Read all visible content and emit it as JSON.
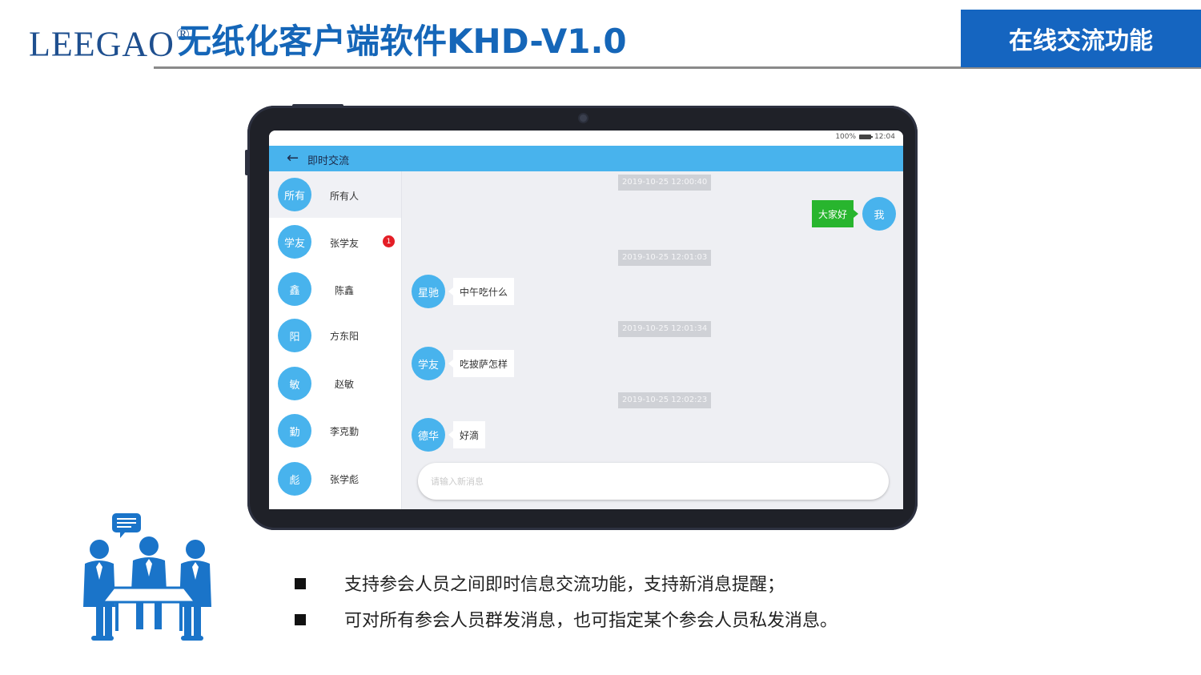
{
  "header": {
    "brand": "LEEGAO",
    "brand_mark": "®",
    "product_title": "无纸化客户端软件KHD-V1.0",
    "feature_tab": "在线交流功能"
  },
  "device": {
    "status": {
      "battery": "100%",
      "time": "12:04"
    },
    "appbar": {
      "title": "即时交流"
    },
    "contacts": [
      {
        "avatar": "所有",
        "name": "所有人",
        "selected": true
      },
      {
        "avatar": "学友",
        "name": "张学友",
        "unread": "1"
      },
      {
        "avatar": "鑫",
        "name": "陈鑫"
      },
      {
        "avatar": "阳",
        "name": "方东阳"
      },
      {
        "avatar": "敏",
        "name": "赵敏"
      },
      {
        "avatar": "勤",
        "name": "李克勤"
      },
      {
        "avatar": "彪",
        "name": "张学彪"
      }
    ],
    "messages": [
      {
        "time": "2019-10-25 12:00:40",
        "direction": "out",
        "avatar": "我",
        "text": "大家好"
      },
      {
        "time": "2019-10-25 12:01:03",
        "direction": "in",
        "avatar": "星驰",
        "text": "中午吃什么"
      },
      {
        "time": "2019-10-25 12:01:34",
        "direction": "in",
        "avatar": "学友",
        "text": "吃披萨怎样"
      },
      {
        "time": "2019-10-25 12:02:23",
        "direction": "in",
        "avatar": "德华",
        "text": "好滴"
      }
    ],
    "input": {
      "placeholder": "请输入新消息",
      "value": ""
    }
  },
  "features": [
    "支持参会人员之间即时信息交流功能，支持新消息提醒；",
    "可对所有参会人员群发消息，也可指定某个参会人员私发消息。"
  ],
  "colors": {
    "brand_blue": "#1566b8",
    "tab_blue": "#1565c0",
    "appbar": "#48b3ed",
    "avatar": "#48b3ed",
    "out_bubble": "#28b52e",
    "badge": "#e41e26",
    "illustration": "#1a74c9"
  },
  "icons": {
    "back": "arrow-left-icon",
    "illustration": "meeting-people-icon"
  }
}
